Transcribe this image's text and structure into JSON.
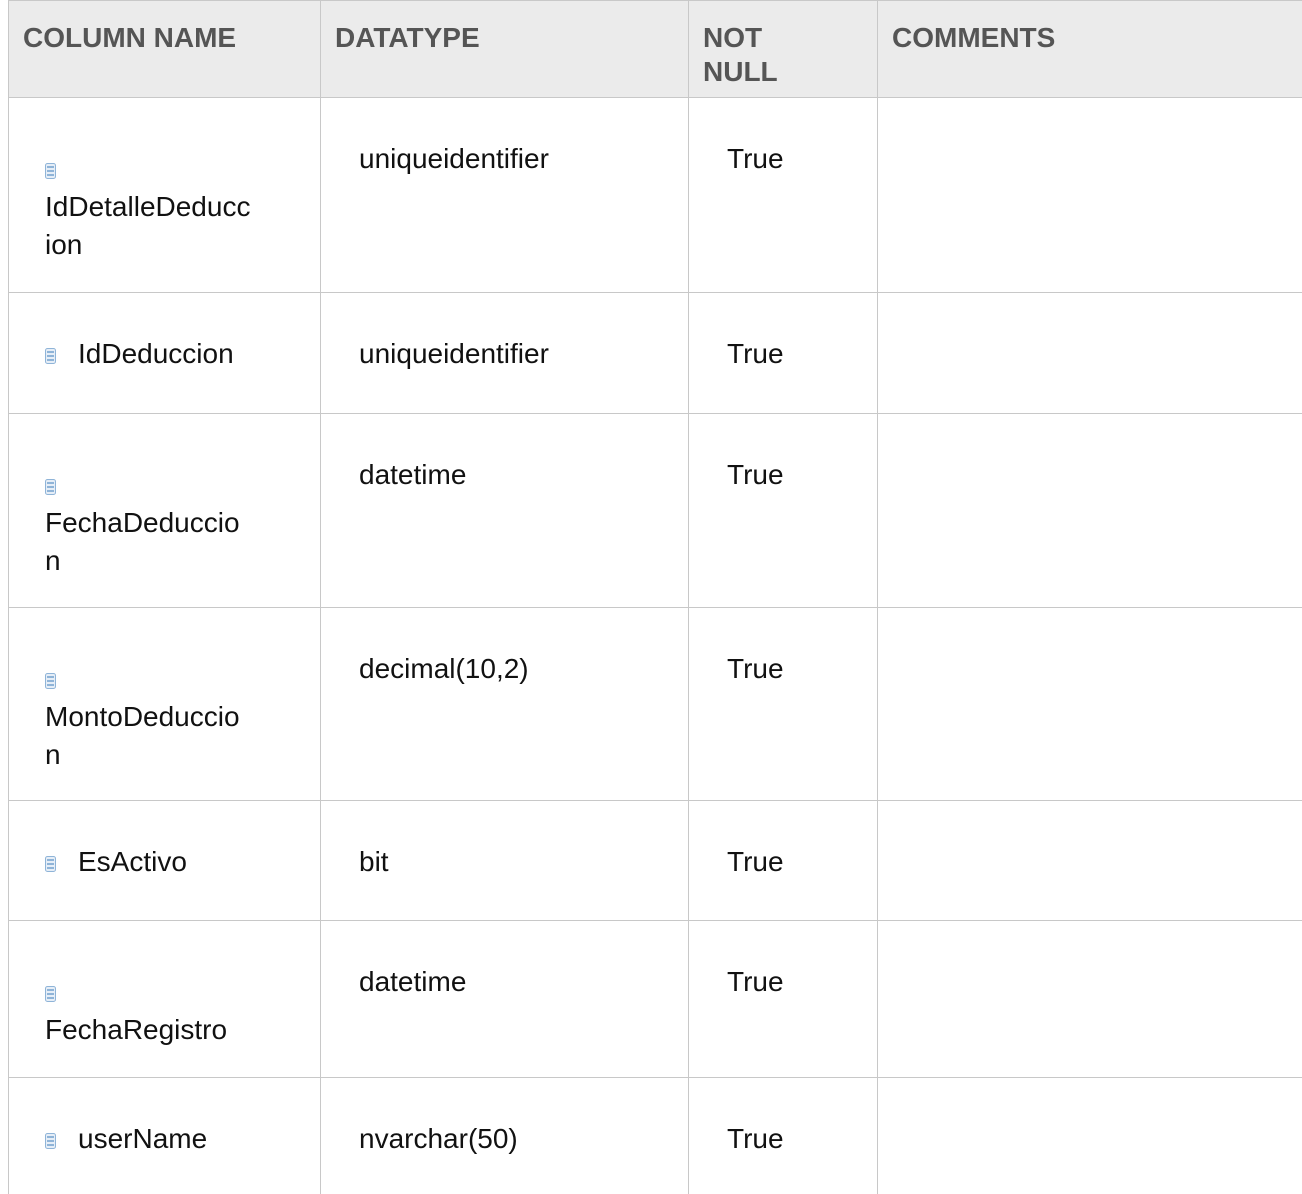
{
  "headers": {
    "column_name": "COLUMN NAME",
    "datatype": "DATATYPE",
    "not_null_line1": "NOT",
    "not_null_line2": "NULL",
    "comments": "COMMENTS"
  },
  "rows": [
    {
      "icon": "column-icon",
      "name_line1": "IdDetalleDeducc",
      "name_line2": "ion",
      "datatype": "uniqueidentifier",
      "not_null": "True",
      "comments": ""
    },
    {
      "icon": "column-icon",
      "name_line1": "IdDeduccion",
      "datatype": "uniqueidentifier",
      "not_null": "True",
      "comments": ""
    },
    {
      "icon": "column-icon",
      "name_line1": "FechaDeduccio",
      "name_line2": "n",
      "datatype": "datetime",
      "not_null": "True",
      "comments": ""
    },
    {
      "icon": "column-icon",
      "name_line1": "MontoDeduccio",
      "name_line2": "n",
      "datatype": "decimal(10,2)",
      "not_null": "True",
      "comments": ""
    },
    {
      "icon": "column-icon",
      "name_line1": "EsActivo",
      "datatype": "bit",
      "not_null": "True",
      "comments": ""
    },
    {
      "icon": "column-icon",
      "name_line1": "FechaRegistro",
      "datatype": "datetime",
      "not_null": "True",
      "comments": ""
    },
    {
      "icon": "column-icon",
      "name_line1": "userName",
      "datatype": "nvarchar(50)",
      "not_null": "True",
      "comments": ""
    }
  ],
  "colors": {
    "header_bg": "#ebebeb",
    "header_text": "#555555",
    "border": "#c8c8c8",
    "icon_blue": "#8fb4d8"
  }
}
